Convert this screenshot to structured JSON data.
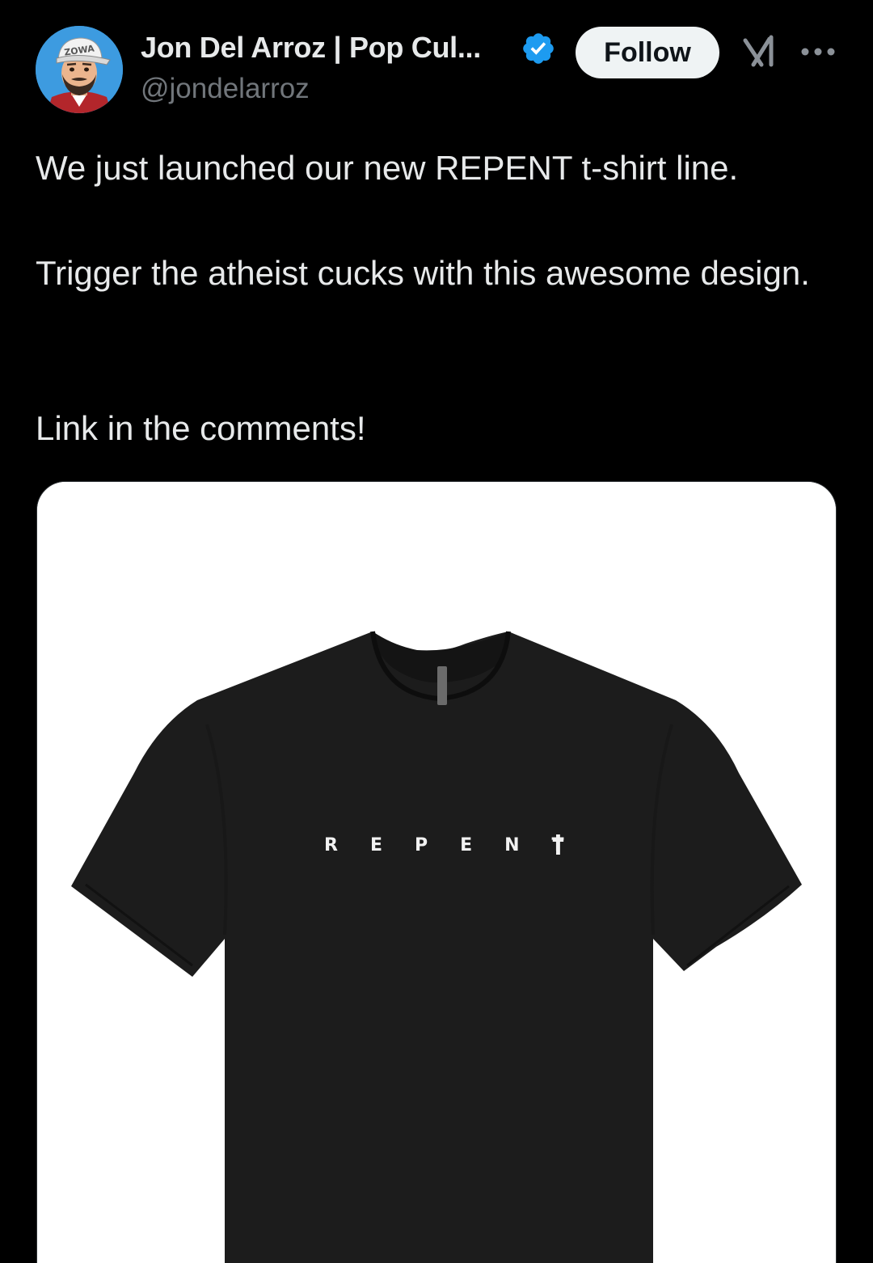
{
  "author": {
    "display_name": "Jon Del Arroz | Pop Cul...",
    "handle": "@jondelarroz",
    "verified": true,
    "avatar_icon": "avatar-cartoon-man-cap-icon",
    "avatar_cap_text": "ZOWA"
  },
  "header": {
    "follow_label": "Follow",
    "grok_icon": "grok-icon",
    "more_icon": "more-dots-icon"
  },
  "tweet": {
    "paragraphs": [
      "We just launched our new REPENT t-shirt line.",
      "Trigger the atheist cucks with this awesome design.",
      "Link in the comments!"
    ]
  },
  "media": {
    "type": "image",
    "subject": "black-tshirt",
    "print_text": "REPENT",
    "print_symbol": "†"
  },
  "colors": {
    "background": "#000000",
    "text_primary": "#e7e9ea",
    "text_secondary": "#71767b",
    "verified_blue": "#1d9bf0",
    "follow_bg": "#eff3f4",
    "shirt": "#1c1c1c"
  }
}
